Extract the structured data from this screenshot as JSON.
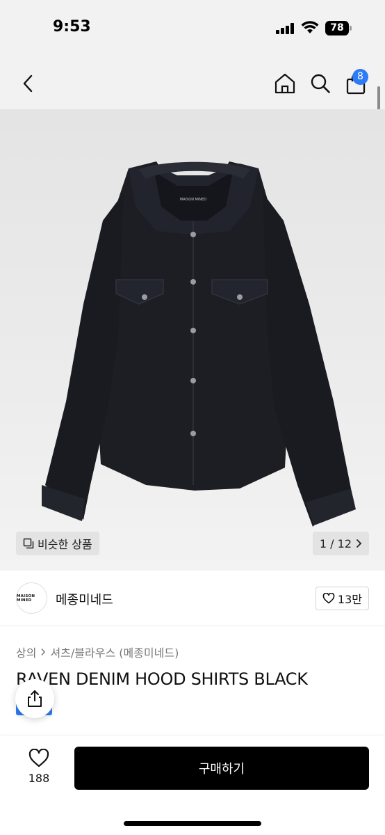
{
  "status_bar": {
    "time": "9:53",
    "battery": "78"
  },
  "nav": {
    "cart_count": "8"
  },
  "gallery": {
    "similar_label": "비슷한 상품",
    "counter": "1 / 12",
    "garment_logo": "MAISON MINED"
  },
  "brand": {
    "logo_text": "MAISON MINED",
    "name": "메종미네드",
    "likes": "13만"
  },
  "product": {
    "breadcrumb": [
      "상의",
      "셔츠/블라우스 (메종미네드)"
    ],
    "title": "RAVEN DENIM HOOD SHIRTS BLACK"
  },
  "bottom_bar": {
    "wish_count": "188",
    "buy_label": "구매하기"
  },
  "colors": {
    "accent": "#2d7bf6",
    "buy_button": "#000000",
    "garment": "#1c1d22"
  }
}
